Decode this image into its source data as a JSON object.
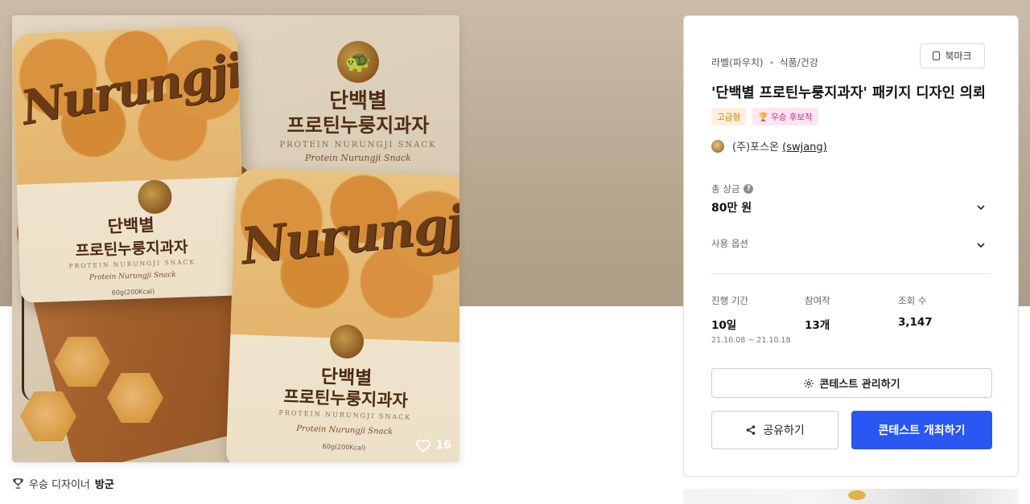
{
  "product": {
    "script_brand": "Nurungji",
    "name_line1": "단백별",
    "name_line2": "프로틴누룽지과자",
    "en_name": "PROTEIN NURUNGJI SNACK",
    "en_script": "Protein Nurungji Snack",
    "weight": "60g(200Kcal)"
  },
  "likes": "16",
  "winner": {
    "label": "우승 디자이너",
    "name": "방군"
  },
  "panel": {
    "category1": "라벨(파우치)",
    "category2": "식품/건강",
    "bookmark_label": "북마크",
    "title": "'단백별 프로틴누룽지과자' 패키지 디자인 의뢰",
    "badge_grade": "고급형",
    "badge_award": "우승 후보작",
    "owner_name": "(주)포스온",
    "owner_id": "(swjang)",
    "prize_label": "총 상금",
    "prize_value": "80만 원",
    "options_label": "사용 옵션",
    "stats": {
      "duration_label": "진행 기간",
      "duration_value": "10일",
      "duration_range": "21.10.08 ~ 21.10.18",
      "entries_label": "참여작",
      "entries_value": "13개",
      "views_label": "조회 수",
      "views_value": "3,147"
    },
    "manage_label": "콘테스트 관리하기",
    "share_label": "공유하기",
    "host_label": "콘테스트 개최하기"
  },
  "colors": {
    "accent": "#2a57f2",
    "grade": "#d97c00",
    "award": "#d1238a"
  }
}
